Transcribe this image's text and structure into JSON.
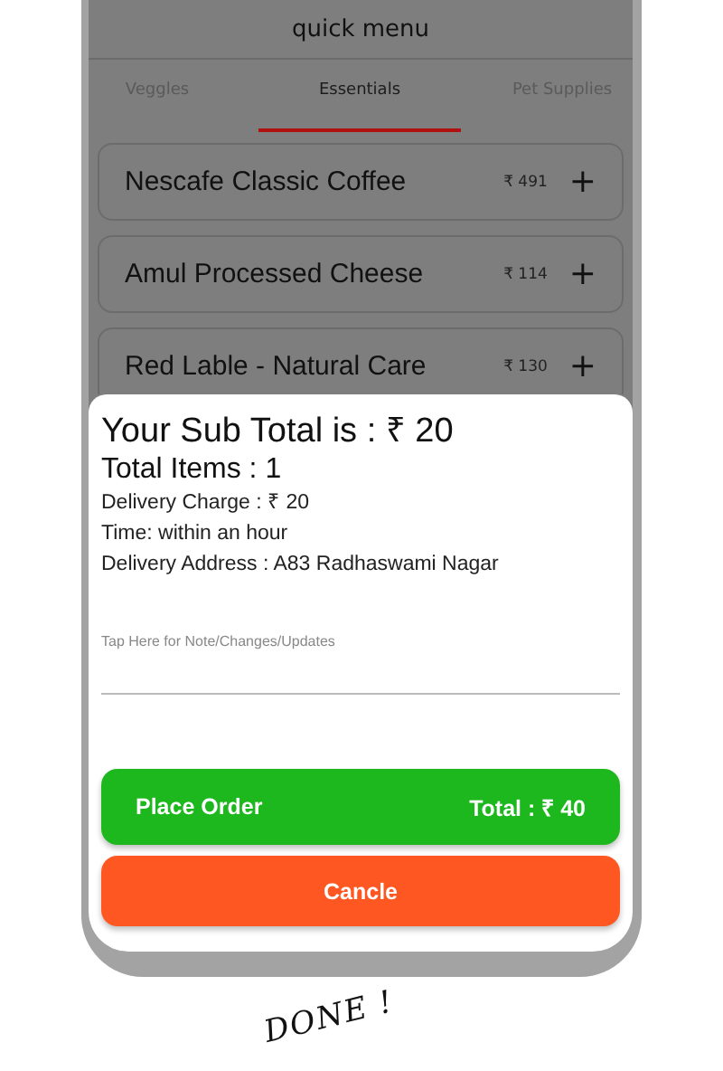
{
  "header": {
    "title": "quick menu"
  },
  "tabs": [
    {
      "label": "Veggles",
      "selected": false
    },
    {
      "label": "Essentials",
      "selected": true
    },
    {
      "label": "Pet Supplies",
      "selected": false
    }
  ],
  "items": [
    {
      "name": "Nescafe Classic Coffee",
      "price": "₹ 491",
      "add": "+"
    },
    {
      "name": "Amul Processed Cheese",
      "price": "₹ 114",
      "add": "+"
    },
    {
      "name": "Red Lable - Natural Care",
      "price": "₹ 130",
      "add": "+"
    }
  ],
  "order_sheet": {
    "subtotal": "Your Sub Total is : ₹ 20",
    "total_items": "Total Items : 1",
    "details": [
      "Delivery Charge : ₹ 20",
      "Time: within an hour",
      "Delivery Address : A83 Radhaswami Nagar"
    ],
    "note_field": {
      "placeholder": "Tap Here for Note/Changes/Updates"
    },
    "place_order": {
      "label": "Place Order",
      "total": "Total : ₹ 40"
    },
    "cancel": {
      "label": "Cancle"
    }
  },
  "caption": "DONE !"
}
